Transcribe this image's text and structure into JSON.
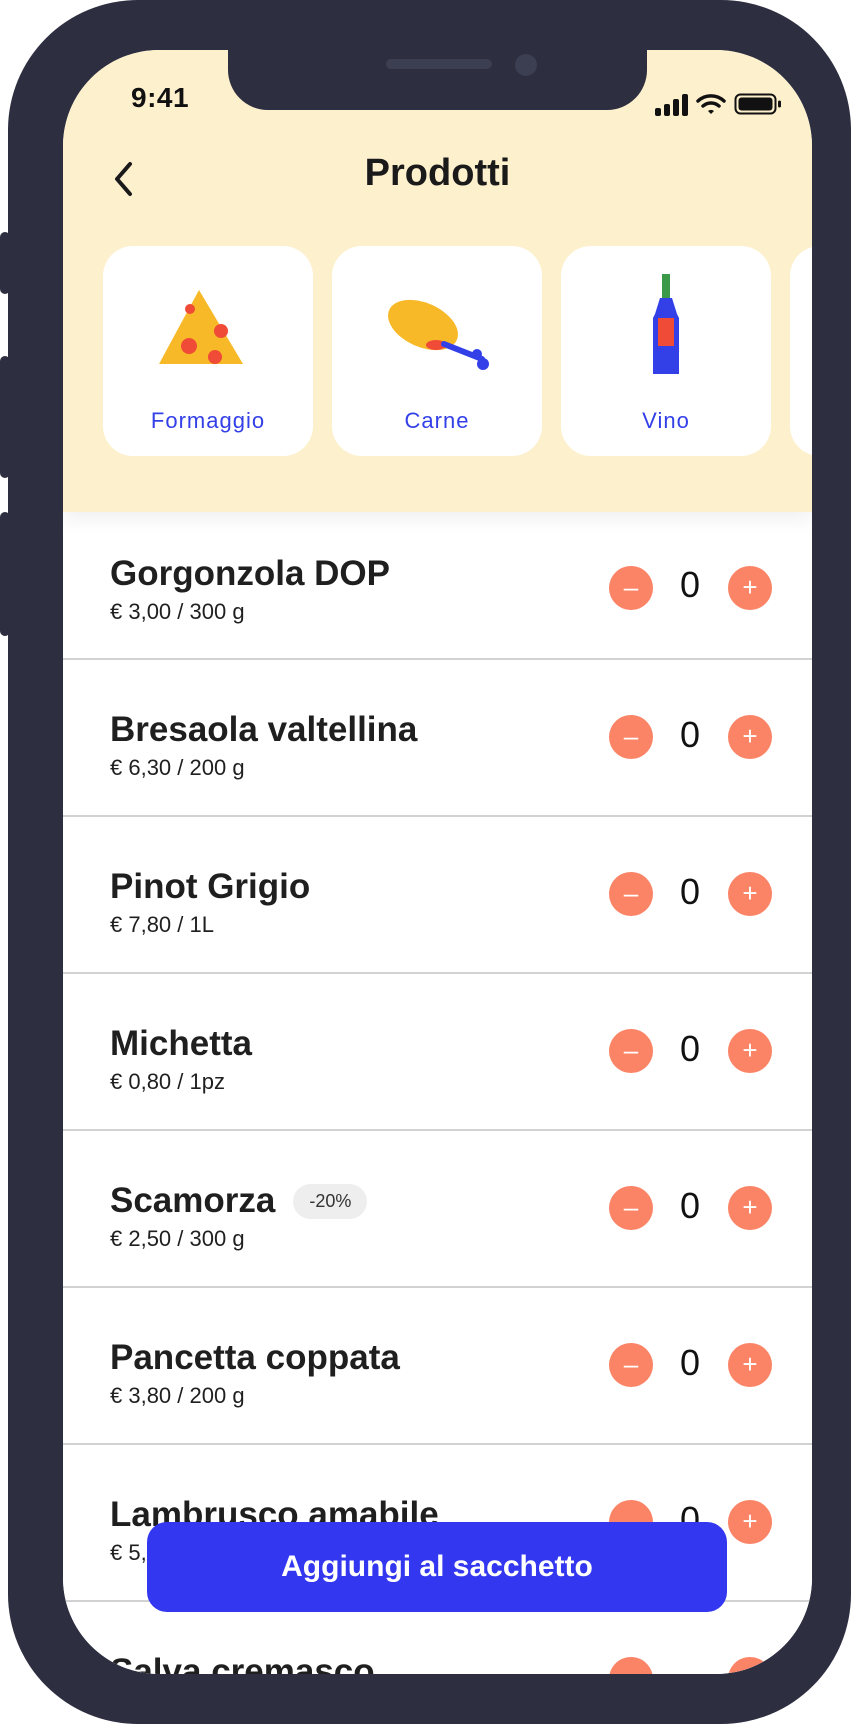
{
  "status": {
    "time": "9:41"
  },
  "header": {
    "title": "Prodotti"
  },
  "categories": [
    {
      "label": "Formaggio",
      "icon": "cheese-icon"
    },
    {
      "label": "Carne",
      "icon": "meat-icon"
    },
    {
      "label": "Vino",
      "icon": "wine-icon"
    }
  ],
  "products": [
    {
      "name": "Gorgonzola DOP",
      "price": "€ 3,00 / 300 g",
      "qty": "0",
      "badge": ""
    },
    {
      "name": "Bresaola valtellina",
      "price": "€ 6,30 / 200 g",
      "qty": "0",
      "badge": ""
    },
    {
      "name": "Pinot Grigio",
      "price": "€ 7,80 / 1L",
      "qty": "0",
      "badge": ""
    },
    {
      "name": "Michetta",
      "price": "€ 0,80 / 1pz",
      "qty": "0",
      "badge": ""
    },
    {
      "name": "Scamorza",
      "price": "€ 2,50 / 300 g",
      "qty": "0",
      "badge": "-20%"
    },
    {
      "name": "Pancetta coppata",
      "price": "€ 3,80 / 200 g",
      "qty": "0",
      "badge": ""
    },
    {
      "name": "Lambrusco amabile",
      "price": "€ 5,",
      "qty": "0",
      "badge": ""
    },
    {
      "name": "Salva cremasco",
      "price": "",
      "qty": "",
      "badge": ""
    }
  ],
  "controls": {
    "minus": "–",
    "plus": "+"
  },
  "cta": {
    "label": "Aggiungi al sacchetto"
  },
  "colors": {
    "accent": "#3338f0",
    "stepper": "#fb8466",
    "header_bg": "#fdf0cd"
  }
}
